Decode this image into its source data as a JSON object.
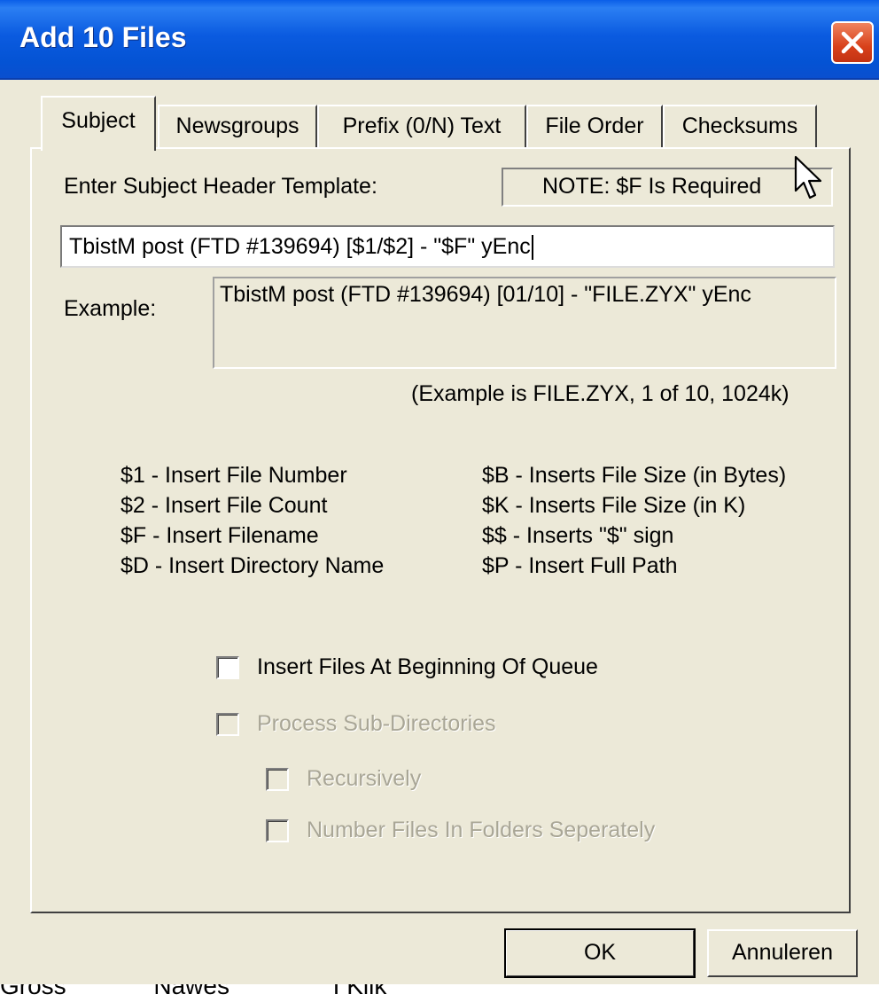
{
  "window": {
    "title": "Add 10 Files"
  },
  "tabs": [
    {
      "label": "Subject",
      "active": true
    },
    {
      "label": "Newsgroups"
    },
    {
      "label": "Prefix (0/N) Text"
    },
    {
      "label": "File Order"
    },
    {
      "label": "Checksums"
    }
  ],
  "subject": {
    "template_label": "Enter Subject Header Template:",
    "note": "NOTE: $F Is Required",
    "template_value": "TbistM post (FTD #139694) [$1/$2] - \"$F\" yEnc",
    "example_label": "Example:",
    "example_value": "TbistM post (FTD #139694) [01/10] - \"FILE.ZYX\" yEnc",
    "example_caption": "(Example is FILE.ZYX, 1 of 10, 1024k)"
  },
  "legend": {
    "left": [
      "$1 - Insert File Number",
      "$2 - Insert File Count",
      "$F - Insert Filename",
      "$D - Insert Directory Name"
    ],
    "right": [
      "$B - Inserts File Size (in Bytes)",
      "$K - Inserts File Size (in K)",
      "$$ - Inserts \"$\" sign",
      "$P - Insert Full Path"
    ]
  },
  "options": {
    "insert_at_beginning": {
      "label": "Insert Files At Beginning Of Queue",
      "checked": false,
      "enabled": true
    },
    "process_subdirs": {
      "label": "Process Sub-Directories",
      "checked": false,
      "enabled": false
    },
    "recursively": {
      "label": "Recursively",
      "checked": false,
      "enabled": false
    },
    "number_separately": {
      "label": "Number Files In Folders Seperately",
      "checked": false,
      "enabled": false
    }
  },
  "buttons": {
    "ok": "OK",
    "cancel": "Annuleren"
  },
  "bottom_text": "Gross            'Nawes               I Klik",
  "colors": {
    "dialog_bg": "#ece9d8",
    "titlebar": "#0453d4",
    "close_button": "#d8411b",
    "disabled_text": "#a9a696"
  },
  "icons": {
    "close": "close-x-icon",
    "cursor": "mouse-pointer-icon"
  }
}
